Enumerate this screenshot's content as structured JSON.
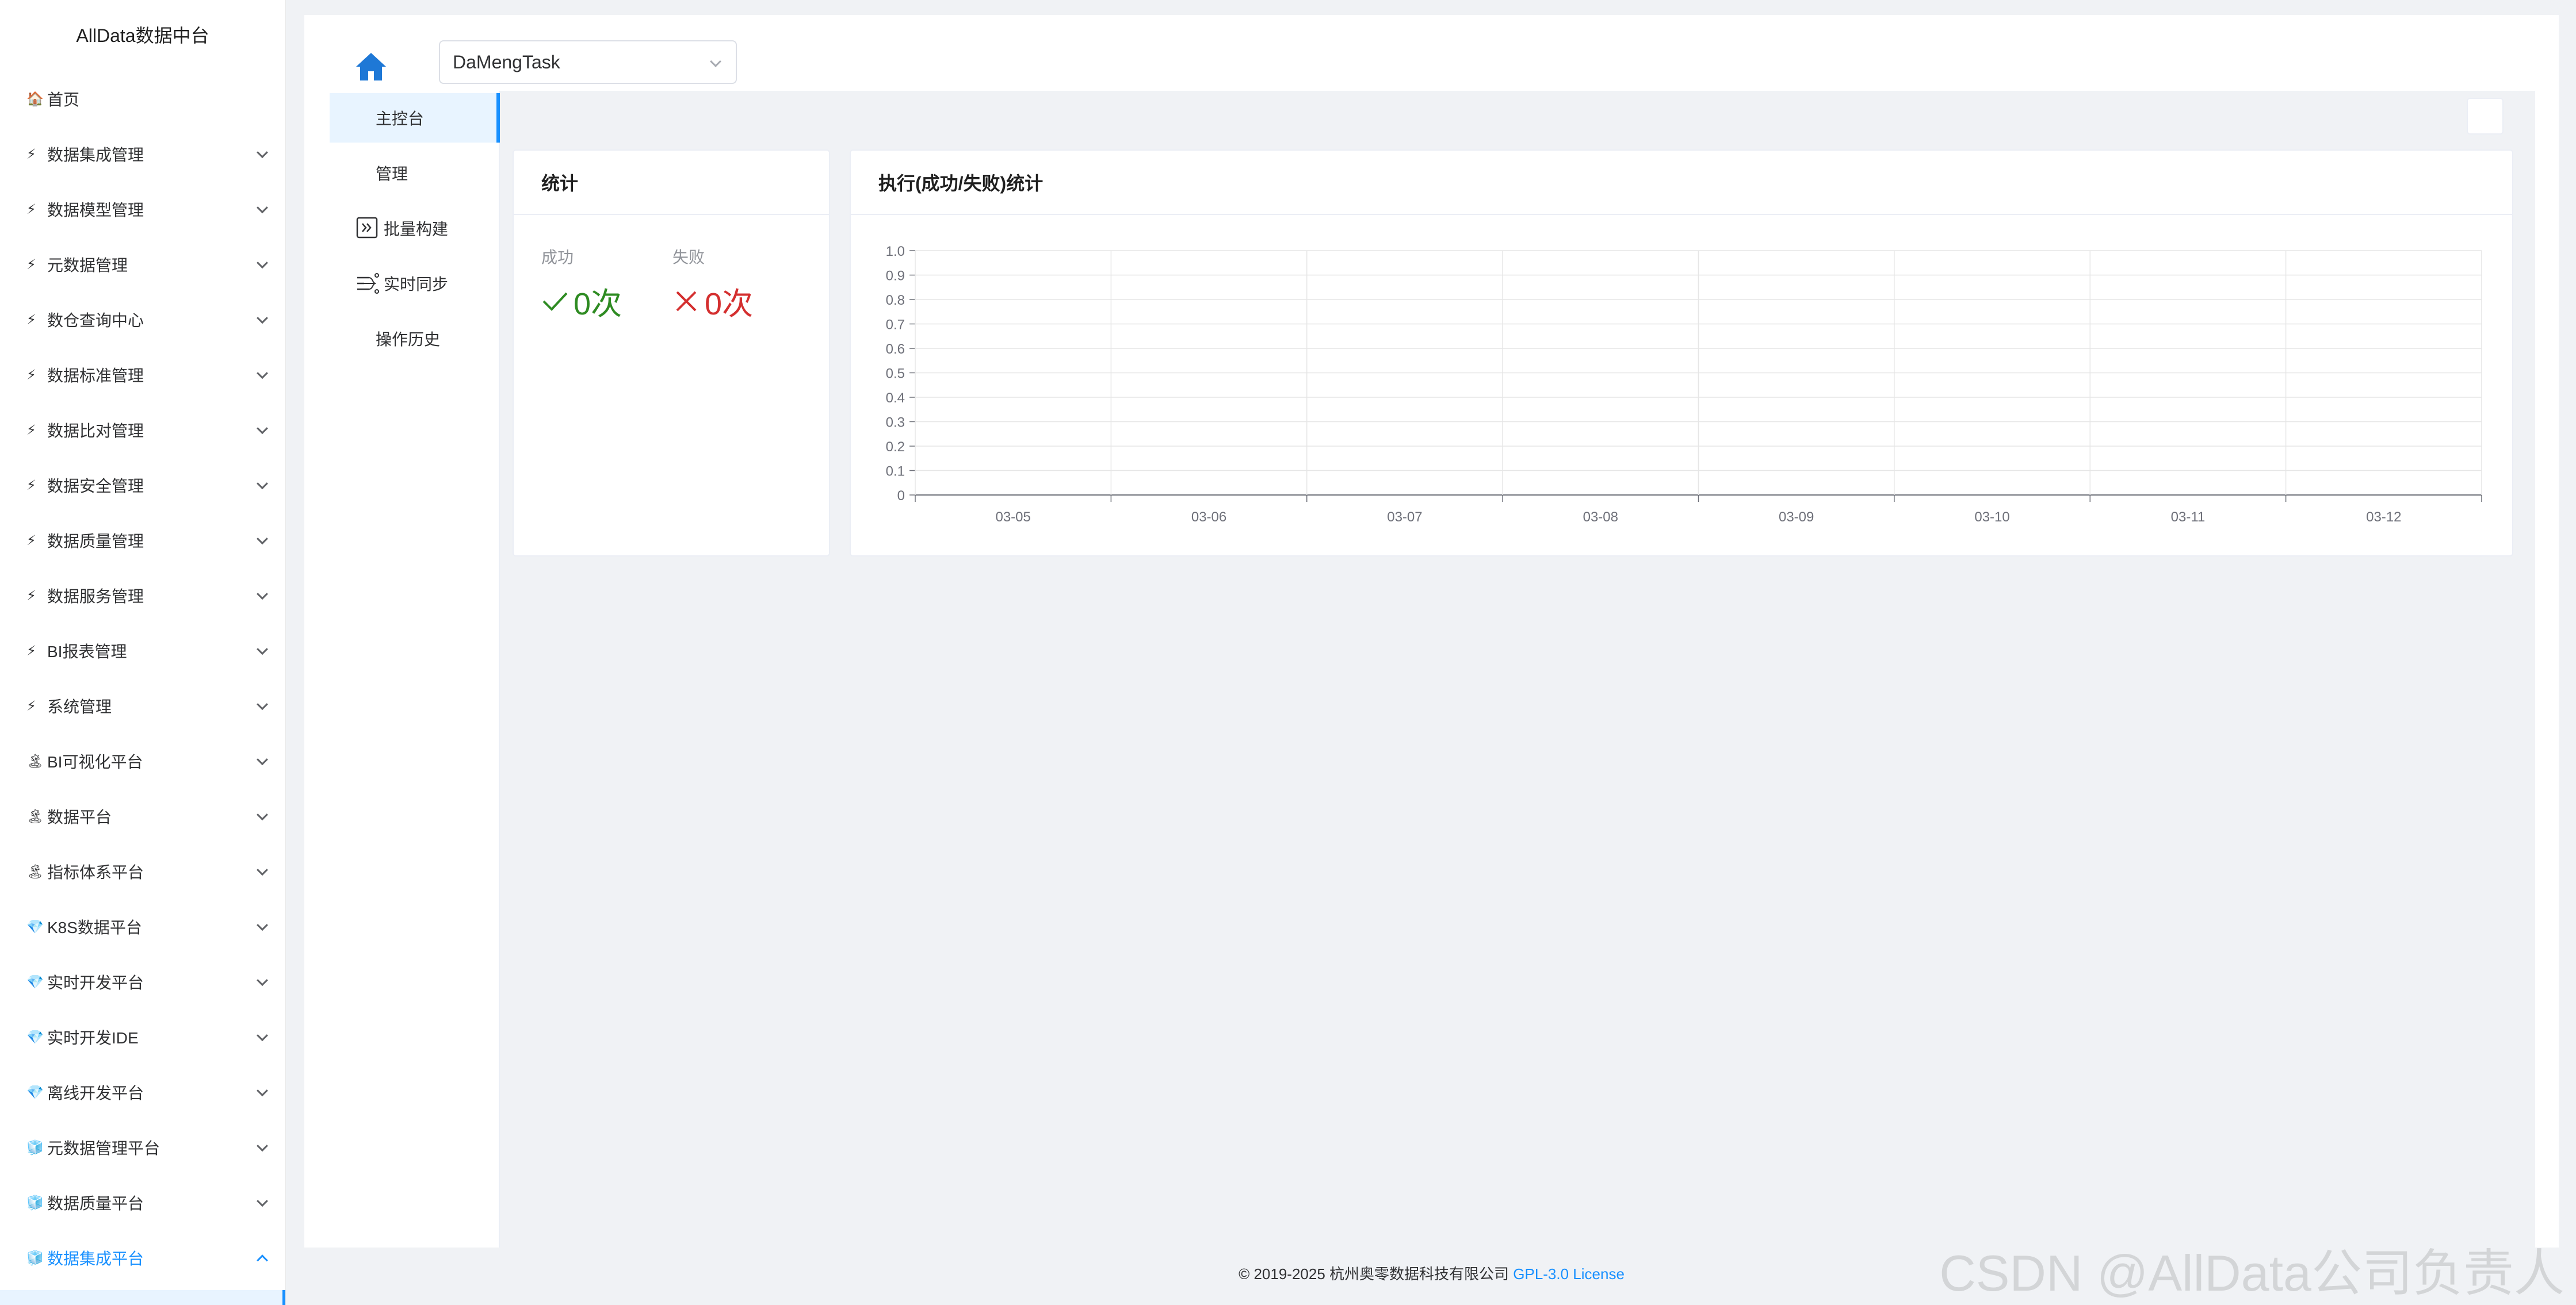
{
  "sidebar": {
    "title": "AllData数据中台",
    "items": [
      {
        "label": "首页",
        "icon": "house-emoji-icon",
        "glyph": "🏠",
        "chevron": false
      },
      {
        "label": "数据集成管理",
        "icon": "lightning-icon",
        "glyph": "⚡",
        "chevron": true
      },
      {
        "label": "数据模型管理",
        "icon": "lightning-icon",
        "glyph": "⚡",
        "chevron": true
      },
      {
        "label": "元数据管理",
        "icon": "lightning-icon",
        "glyph": "⚡",
        "chevron": true
      },
      {
        "label": "数仓查询中心",
        "icon": "lightning-icon",
        "glyph": "⚡",
        "chevron": true
      },
      {
        "label": "数据标准管理",
        "icon": "lightning-icon",
        "glyph": "⚡",
        "chevron": true
      },
      {
        "label": "数据比对管理",
        "icon": "lightning-icon",
        "glyph": "⚡",
        "chevron": true
      },
      {
        "label": "数据安全管理",
        "icon": "lightning-icon",
        "glyph": "⚡",
        "chevron": true
      },
      {
        "label": "数据质量管理",
        "icon": "lightning-icon",
        "glyph": "⚡",
        "chevron": true
      },
      {
        "label": "数据服务管理",
        "icon": "lightning-icon",
        "glyph": "⚡",
        "chevron": true
      },
      {
        "label": "BI报表管理",
        "icon": "lightning-icon",
        "glyph": "⚡",
        "chevron": true
      },
      {
        "label": "系统管理",
        "icon": "lightning-icon",
        "glyph": "⚡",
        "chevron": true
      },
      {
        "label": "BI可视化平台",
        "icon": "island-icon",
        "glyph": "🏝",
        "chevron": true
      },
      {
        "label": "数据平台",
        "icon": "island-icon",
        "glyph": "🏝",
        "chevron": true
      },
      {
        "label": "指标体系平台",
        "icon": "island-icon",
        "glyph": "🏝",
        "chevron": true
      },
      {
        "label": "K8S数据平台",
        "icon": "gem-icon",
        "glyph": "💎",
        "chevron": true
      },
      {
        "label": "实时开发平台",
        "icon": "gem-icon",
        "glyph": "💎",
        "chevron": true
      },
      {
        "label": "实时开发IDE",
        "icon": "gem-icon",
        "glyph": "💎",
        "chevron": true
      },
      {
        "label": "离线开发平台",
        "icon": "gem-icon",
        "glyph": "💎",
        "chevron": true
      },
      {
        "label": "元数据管理平台",
        "icon": "ice-icon",
        "glyph": "🧊",
        "chevron": true
      },
      {
        "label": "数据质量平台",
        "icon": "ice-icon",
        "glyph": "🧊",
        "chevron": true
      },
      {
        "label": "数据集成平台",
        "icon": "ice-icon",
        "glyph": "🧊",
        "chevron": true,
        "open": true
      }
    ]
  },
  "header": {
    "home_icon": "home-icon",
    "datasource_select": "DaMengTask"
  },
  "inner_nav": [
    {
      "label": "主控台",
      "active": true,
      "icon": null
    },
    {
      "label": "管理",
      "active": false,
      "icon": null
    },
    {
      "label": "批量构建",
      "active": false,
      "icon": "batch-build-icon"
    },
    {
      "label": "实时同步",
      "active": false,
      "icon": "realtime-sync-icon"
    },
    {
      "label": "操作历史",
      "active": false,
      "icon": null
    }
  ],
  "stats_card": {
    "title": "统计",
    "success_label": "成功",
    "success_value": "0次",
    "fail_label": "失败",
    "fail_value": "0次",
    "success_color": "#2e8b22",
    "fail_color": "#d42f2f"
  },
  "chart_card": {
    "title": "执行(成功/失败)统计"
  },
  "chart_data": {
    "type": "line",
    "title": "",
    "xlabel": "",
    "ylabel": "",
    "categories": [
      "03-05",
      "03-06",
      "03-07",
      "03-08",
      "03-09",
      "03-10",
      "03-11",
      "03-12"
    ],
    "y_ticks": [
      "0",
      "0.1",
      "0.2",
      "0.3",
      "0.4",
      "0.5",
      "0.6",
      "0.7",
      "0.8",
      "0.9",
      "1.0"
    ],
    "ylim": [
      0,
      1
    ],
    "grid": true,
    "series": []
  },
  "footer": {
    "copyright": "© 2019-2025 杭州奥零数据科技有限公司",
    "license": "GPL-3.0 License"
  },
  "watermark": "CSDN @AllData公司负责人",
  "colors": {
    "accent": "#1890ff",
    "background": "#f0f2f5"
  }
}
